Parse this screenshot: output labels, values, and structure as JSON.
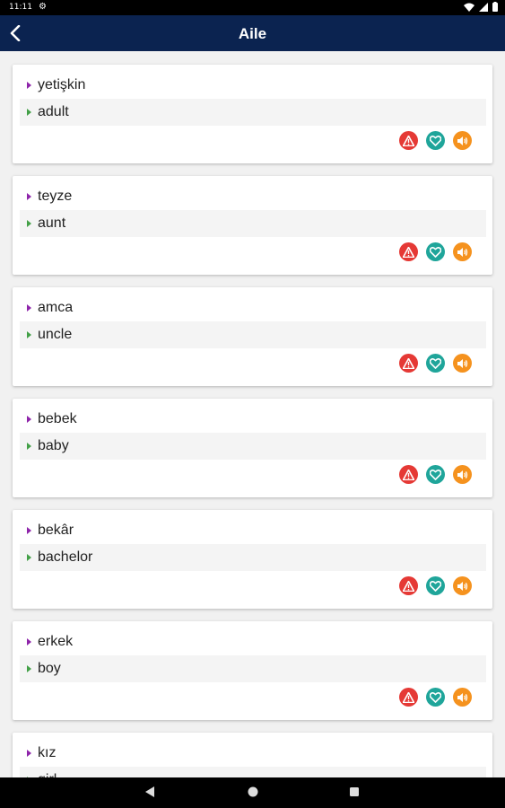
{
  "status_bar": {
    "time": "11:11"
  },
  "app_bar": {
    "title": "Aile"
  },
  "colors": {
    "app_bar": "#0b2350",
    "word_bullet": "#8e24aa",
    "translation_bullet": "#43a047",
    "report_button": "#e53935",
    "favorite_button": "#1fa59a",
    "audio_button": "#f5921e"
  },
  "icons": {
    "back": "back-arrow-icon",
    "report": "warning-icon",
    "favorite": "heart-icon",
    "audio": "speaker-icon"
  },
  "cards": [
    {
      "word": "yetişkin",
      "translation": "adult"
    },
    {
      "word": "teyze",
      "translation": "aunt"
    },
    {
      "word": "amca",
      "translation": "uncle"
    },
    {
      "word": "bebek",
      "translation": "baby"
    },
    {
      "word": "bekâr",
      "translation": "bachelor"
    },
    {
      "word": "erkek",
      "translation": "boy"
    },
    {
      "word": "kız",
      "translation": "girl"
    }
  ]
}
